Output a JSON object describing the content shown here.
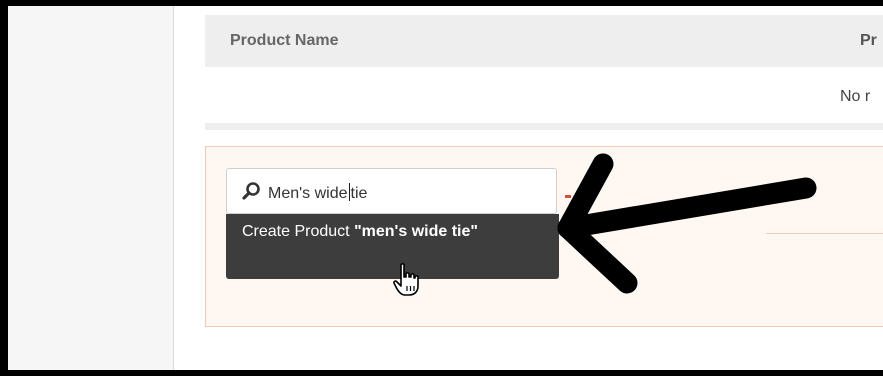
{
  "table": {
    "columns": [
      "Product Name",
      "Pr"
    ],
    "empty_text": "No r"
  },
  "search": {
    "value_before_caret": "Men's wide",
    "value_after_caret": "tie"
  },
  "suggestion": {
    "prefix": "Create Product ",
    "term": "\"men's wide tie\""
  },
  "icons": {
    "search": "search-icon",
    "cursor": "hand-pointer-cursor-icon",
    "arrow": "annotation-arrow-icon"
  },
  "colors": {
    "panel_background": "#fff7f1",
    "panel_border": "#f2c9b2",
    "dropdown_background": "#3d3d3d",
    "header_background": "#eeeeee",
    "annotation_arrow": "#000000"
  }
}
